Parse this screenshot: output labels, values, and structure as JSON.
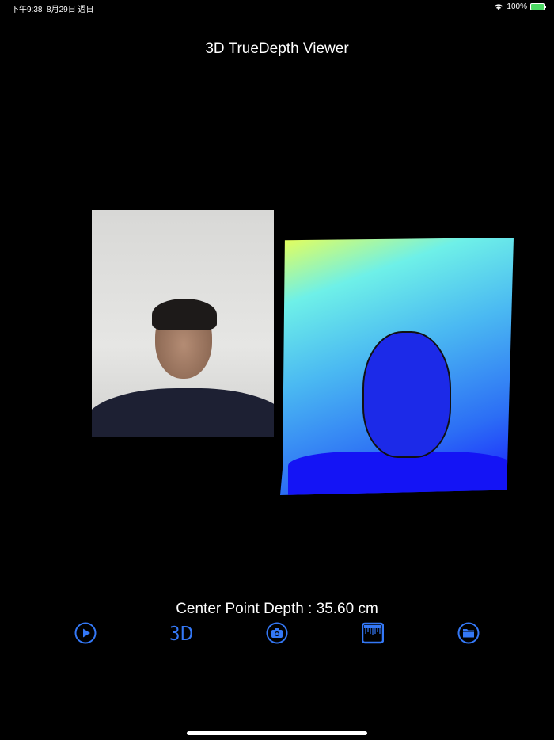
{
  "status_bar": {
    "time": "下午9:38",
    "date": "8月29日 週日",
    "battery": "100%"
  },
  "title": "3D TrueDepth Viewer",
  "center_depth_label": "Center Point Depth : 35.60 cm",
  "toolbar": {
    "three_d_label": "3D",
    "items": [
      "play-icon",
      "3d-button",
      "camera-icon",
      "ruler-icon",
      "folder-icon"
    ]
  },
  "colors": {
    "accent": "#3478f6"
  }
}
